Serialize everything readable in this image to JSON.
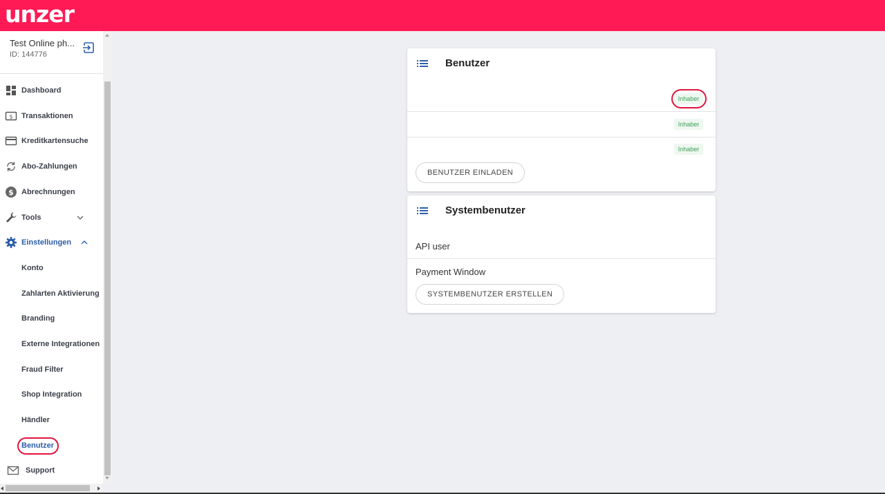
{
  "brand": {
    "logo_text": "unzer",
    "accent": "#ff1a55"
  },
  "merchant": {
    "name": "Test Online ph...",
    "id_label": "ID: 144776"
  },
  "nav": {
    "dashboard": "Dashboard",
    "transaktionen": "Transaktionen",
    "kreditkartensuche": "Kreditkartensuche",
    "abo": "Abo-Zahlungen",
    "abrechnungen": "Abrechnungen",
    "tools": "Tools",
    "einstellungen": "Einstellungen",
    "support": "Support"
  },
  "settings_sub": {
    "konto": "Konto",
    "zahlarten": "Zahlarten Aktivierung",
    "branding": "Branding",
    "externe": "Externe Integrationen",
    "fraud": "Fraud Filter",
    "shop": "Shop Integration",
    "haendler": "Händler",
    "benutzer": "Benutzer"
  },
  "benutzer_card": {
    "title": "Benutzer",
    "badges": [
      "Inhaber",
      "Inhaber",
      "Inhaber"
    ],
    "invite_button": "BENUTZER EINLADEN"
  },
  "system_card": {
    "title": "Systembenutzer",
    "rows": [
      "API user",
      "Payment Window"
    ],
    "create_button": "SYSTEMBENUTZER ERSTELLEN"
  }
}
